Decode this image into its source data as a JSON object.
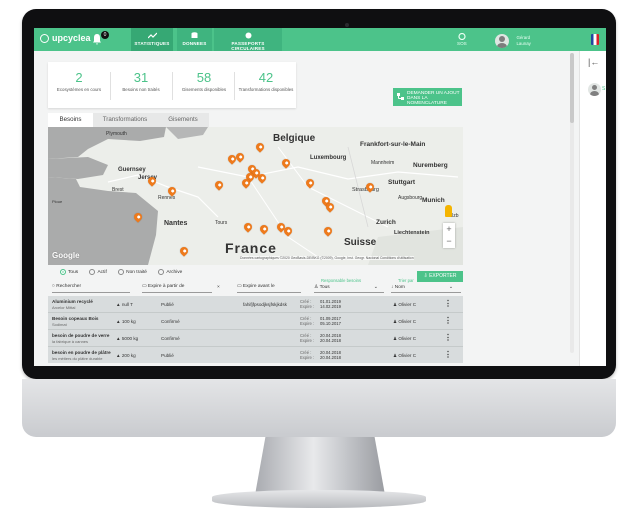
{
  "header": {
    "logo": "upcyclea",
    "notifications_count": "0",
    "nav": [
      {
        "label": "STATISTIQUES"
      },
      {
        "label": "DONNEES"
      },
      {
        "label": "PASSEPORTS CIRCULAIRES"
      }
    ],
    "sos_label": "SOS",
    "user_name_line1": "Gérard",
    "user_name_line2": "Launay"
  },
  "stats": [
    {
      "value": "2",
      "label": "Ecosystèmes en cours"
    },
    {
      "value": "31",
      "label": "Besoins non traités"
    },
    {
      "value": "58",
      "label": "Gisements disponibles"
    },
    {
      "value": "42",
      "label": "Transformations disponibles"
    }
  ],
  "ask_button": "DEMANDER UN AJOUT DANS LA NOMENCLATURE",
  "tabs": [
    "Besoins",
    "Transformations",
    "Gisements"
  ],
  "map": {
    "labels": {
      "belgique": "Belgique",
      "plymouth": "Plymouth",
      "guernsey": "Guernsey",
      "jersey": "Jersey",
      "luxembourg": "Luxembourg",
      "frankfurt": "Frankfort-sur-le-Main",
      "mannheim": "Mannheim",
      "nuremberg": "Nuremberg",
      "stuttgart": "Stuttgart",
      "strasbourg": "Strasbourg",
      "augsburg": "Augsbourg",
      "munich": "Munich",
      "salzburg": "Salzb",
      "zurich": "Zurich",
      "liechtenstein": "Liechtenstein",
      "suisse": "Suisse",
      "rennes": "Rennes",
      "nantes": "Nantes",
      "tours": "Tours",
      "brest": "Brest",
      "france": "France",
      "ploue": "Ploue"
    },
    "google": "Google",
    "attribution": "Données cartographiques ©2020 GeoBasis-DE/BKG (©2009), Google, Inst. Geogr. Nacional   Conditions d'utilisation",
    "zoom_in": "+",
    "zoom_out": "−"
  },
  "filters": [
    "Tous",
    "Actif",
    "Non traité",
    "Archive"
  ],
  "export_label": "EXPORTER",
  "columns": {
    "search_placeholder": "Rechercher",
    "expire_from": "Expire à partir de",
    "expire_before": "Expire avant le",
    "resp_title": "Responsable besoins",
    "resp_value": "Tous",
    "sort_title": "Trier par",
    "sort_value": "Nom"
  },
  "rows": [
    {
      "name": "Aluminium recyclé",
      "org": "Arcelor Mittal",
      "qty": "null T",
      "status": "Publié",
      "extra": "fahifjfpsodjksjfskjkdsk",
      "created": "01.01.2019",
      "expires": "14.02.2019",
      "owner": "Olivier C"
    },
    {
      "name": "Besoin copeaux Bois",
      "org": "Sodimat",
      "qty": "100 kg",
      "status": "Confirmé",
      "extra": "",
      "created": "01.09.2017",
      "expires": "05.10.2017",
      "owner": "Olivier C"
    },
    {
      "name": "besoin de poudre de verre",
      "org": "la fabrique à cannes",
      "qty": "5000 kg",
      "status": "Confirmé",
      "extra": "",
      "created": "20.04.2018",
      "expires": "20.04.2018",
      "owner": "Olivier C"
    },
    {
      "name": "besoin en poudre de plâtre",
      "org": "les métiers du plâtre durable",
      "qty": "200 kg",
      "status": "Publié",
      "extra": "",
      "created": "20.04.2018",
      "expires": "20.04.2018",
      "owner": "Olivier C"
    }
  ],
  "date_labels": {
    "created": "Créé :",
    "expires": "Expire :"
  },
  "colors": {
    "accent": "#4cc38a",
    "accent_dark": "#36a874",
    "pin": "#ee7a1c"
  }
}
